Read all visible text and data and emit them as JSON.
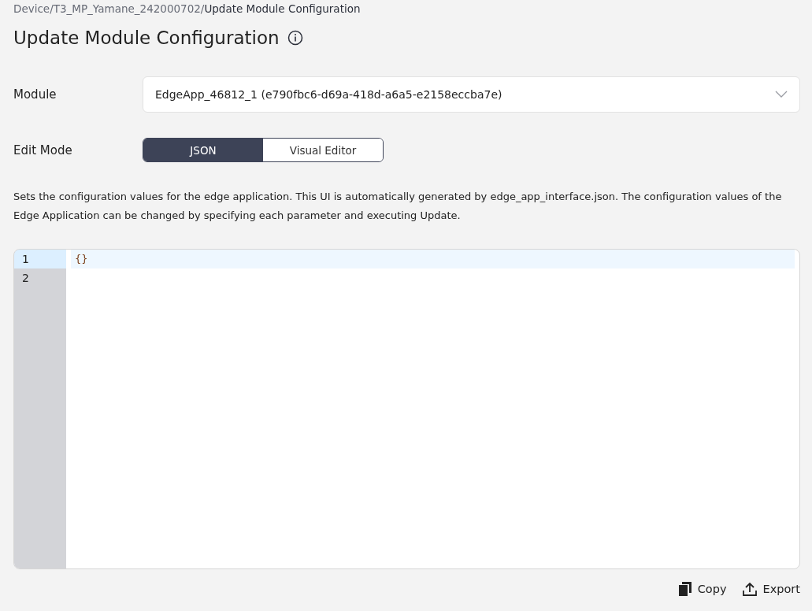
{
  "breadcrumb": [
    {
      "label": "Device/",
      "current": false
    },
    {
      "label": "T3_MP_Yamane_242000702/",
      "current": false
    },
    {
      "label": "Update Module Configuration",
      "current": true
    }
  ],
  "title": "Update Module Configuration",
  "module": {
    "label": "Module",
    "value": "EdgeApp_46812_1 (e790fbc6-d69a-418d-a6a5-e2158eccba7e)"
  },
  "edit_mode": {
    "label": "Edit Mode",
    "options": [
      {
        "label": "JSON",
        "selected": true
      },
      {
        "label": "Visual Editor",
        "selected": false
      }
    ]
  },
  "description": "Sets the configuration values for the edge application. This UI is automatically generated by edge_app_interface.json. The configuration values of the Edge Application can be changed by specifying each parameter and executing Update.",
  "editor": {
    "lines": [
      {
        "number": "1",
        "text": "{}",
        "selected": true
      },
      {
        "number": "2",
        "selected": false
      }
    ]
  },
  "actions": [
    {
      "kind": "copy",
      "label": "Copy"
    },
    {
      "kind": "export",
      "label": "Export"
    }
  ]
}
